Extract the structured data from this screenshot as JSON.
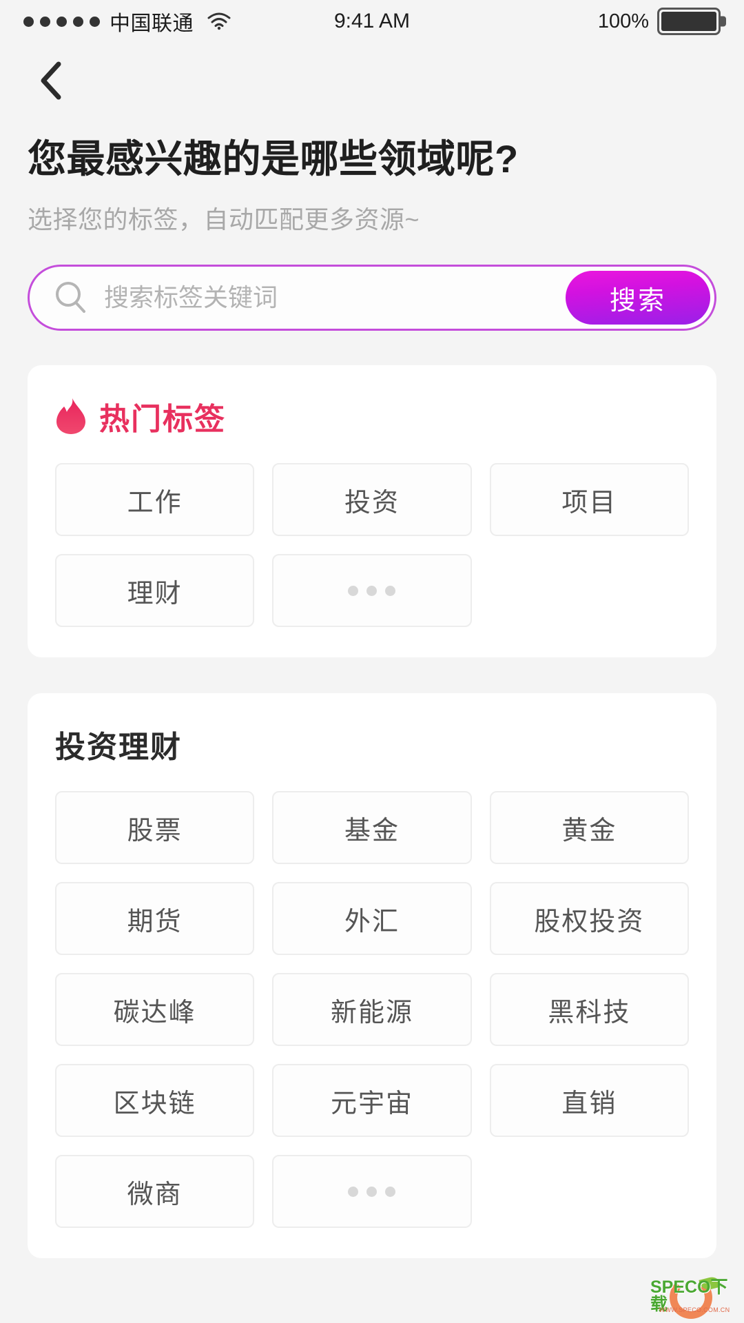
{
  "status_bar": {
    "signal_dots": 5,
    "carrier": "中国联通",
    "wifi_icon": "wifi-icon",
    "time": "9:41 AM",
    "battery_percent": "100%",
    "battery_icon": "battery-full-icon"
  },
  "nav": {
    "back_icon": "chevron-left-icon"
  },
  "header": {
    "title": "您最感兴趣的是哪些领域呢?",
    "subtitle": "选择您的标签，自动匹配更多资源~"
  },
  "search": {
    "icon": "search-icon",
    "placeholder": "搜索标签关键词",
    "value": "",
    "button_label": "搜索",
    "border_color": "#c44ddb",
    "button_gradient_from": "#ea17dd",
    "button_gradient_to": "#9a20e8"
  },
  "sections": [
    {
      "id": "hot-tags",
      "icon": "flame-icon",
      "title": "热门标签",
      "title_color": "#e8305e",
      "tags": [
        "工作",
        "投资",
        "项目",
        "理财"
      ],
      "more_label": "•••",
      "has_more": true
    },
    {
      "id": "investment",
      "icon": null,
      "title": "投资理财",
      "title_color": "#2b2b2b",
      "tags": [
        "股票",
        "基金",
        "黄金",
        "期货",
        "外汇",
        "股权投资",
        "碳达峰",
        "新能源",
        "黑科技",
        "区块链",
        "元宇宙",
        "直销",
        "微商"
      ],
      "more_label": "•••",
      "has_more": true
    }
  ],
  "watermark": {
    "text": "SPECO下载",
    "url": "WWW.SPECO.COM.CN"
  }
}
